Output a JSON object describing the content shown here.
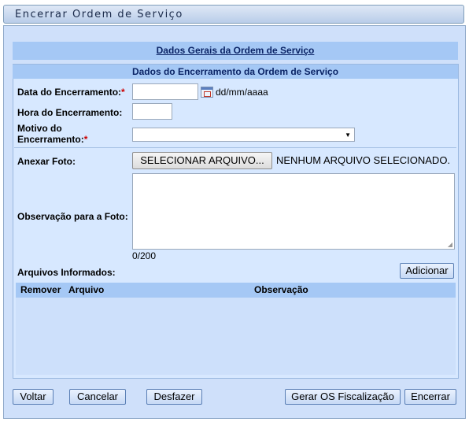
{
  "window": {
    "title": "Encerrar Ordem de Serviço"
  },
  "sections": {
    "dados_gerais": "Dados Gerais da Ordem de Serviço",
    "dados_encerramento": "Dados do Encerramento da Ordem de Serviço"
  },
  "form": {
    "data_label": "Data do Encerramento:",
    "data_value": "",
    "date_hint": "dd/mm/aaaa",
    "hora_label": "Hora do Encerramento:",
    "hora_value": "",
    "motivo_label_1": "Motivo do",
    "motivo_label_2": "Encerramento:",
    "motivo_value": "",
    "required_mark": "*",
    "anexar_label": "Anexar Foto:",
    "file_button": "SELECIONAR ARQUIVO...",
    "file_status": "NENHUM ARQUIVO SELECIONADO.",
    "obs_label": "Observação para a Foto:",
    "obs_counter": "0/200",
    "arquivos_label": "Arquivos Informados:",
    "adicionar_button": "Adicionar"
  },
  "table": {
    "columns": [
      "Remover",
      "Arquivo",
      "Observação"
    ],
    "rows": []
  },
  "footer": {
    "voltar": "Voltar",
    "cancelar": "Cancelar",
    "desfazer": "Desfazer",
    "gerar": "Gerar OS Fiscalização",
    "encerrar": "Encerrar"
  },
  "icons": {
    "calendar": "calendar-icon",
    "dropdown": "chevron-down-icon"
  },
  "colors": {
    "section_bar": "#a5c8f5",
    "panel": "#d7e8ff",
    "required": "#cc0000"
  }
}
